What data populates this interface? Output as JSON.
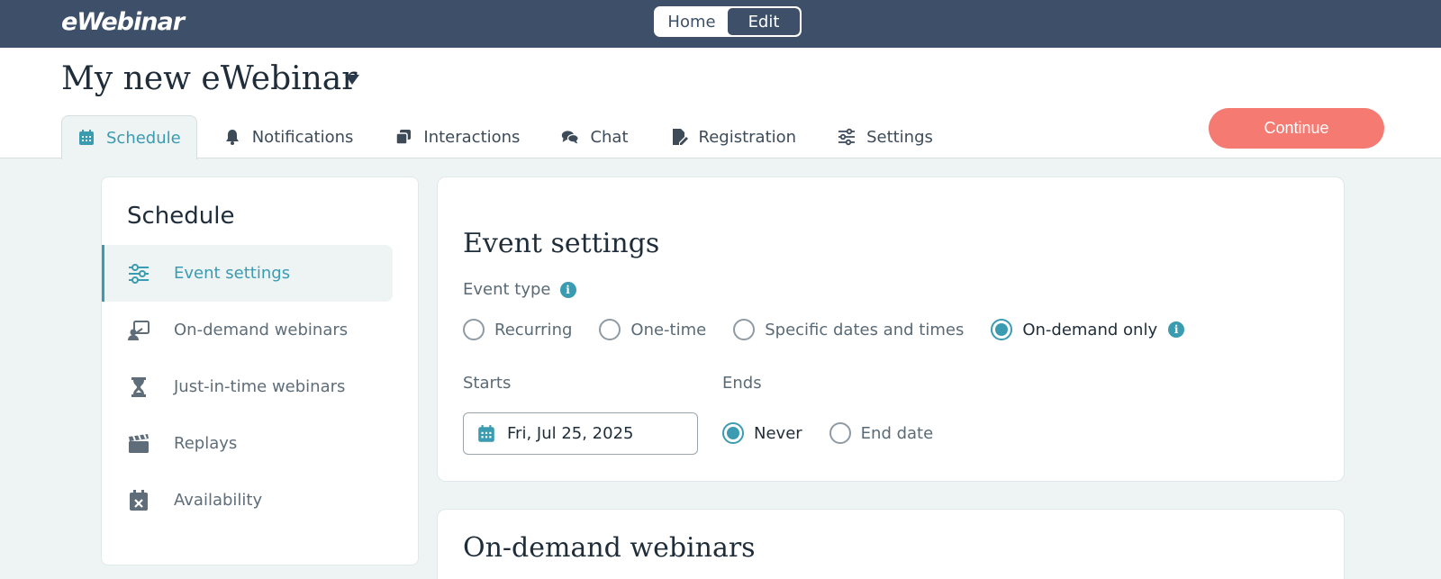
{
  "app": {
    "logo": "eWebinar",
    "toggle": {
      "home": "Home",
      "edit": "Edit",
      "active": "Edit"
    }
  },
  "header": {
    "title": "My new eWebinar",
    "tabs": [
      {
        "label": "Schedule",
        "icon": "calendar-icon",
        "active": true
      },
      {
        "label": "Notifications",
        "icon": "bell-icon"
      },
      {
        "label": "Interactions",
        "icon": "cards-icon"
      },
      {
        "label": "Chat",
        "icon": "chat-icon"
      },
      {
        "label": "Registration",
        "icon": "form-edit-icon"
      },
      {
        "label": "Settings",
        "icon": "sliders-icon"
      }
    ],
    "continue_label": "Continue"
  },
  "sidebar": {
    "title": "Schedule",
    "items": [
      {
        "label": "Event settings",
        "icon": "sliders-icon",
        "active": true
      },
      {
        "label": "On-demand webinars",
        "icon": "presenter-icon"
      },
      {
        "label": "Just-in-time webinars",
        "icon": "hourglass-icon"
      },
      {
        "label": "Replays",
        "icon": "clapperboard-icon"
      },
      {
        "label": "Availability",
        "icon": "calendar-x-icon"
      }
    ]
  },
  "event_settings": {
    "heading": "Event settings",
    "event_type_label": "Event type",
    "event_types": [
      {
        "label": "Recurring",
        "selected": false
      },
      {
        "label": "One-time",
        "selected": false
      },
      {
        "label": "Specific dates and times",
        "selected": false
      },
      {
        "label": "On-demand only",
        "selected": true
      }
    ],
    "starts_label": "Starts",
    "start_date": "Fri, Jul 25, 2025",
    "ends_label": "Ends",
    "ends_options": [
      {
        "label": "Never",
        "selected": true
      },
      {
        "label": "End date",
        "selected": false
      }
    ]
  },
  "on_demand": {
    "heading": "On-demand webinars"
  },
  "colors": {
    "accent": "#3b9bb0",
    "topbar": "#3e5069",
    "cta": "#f47a72"
  }
}
